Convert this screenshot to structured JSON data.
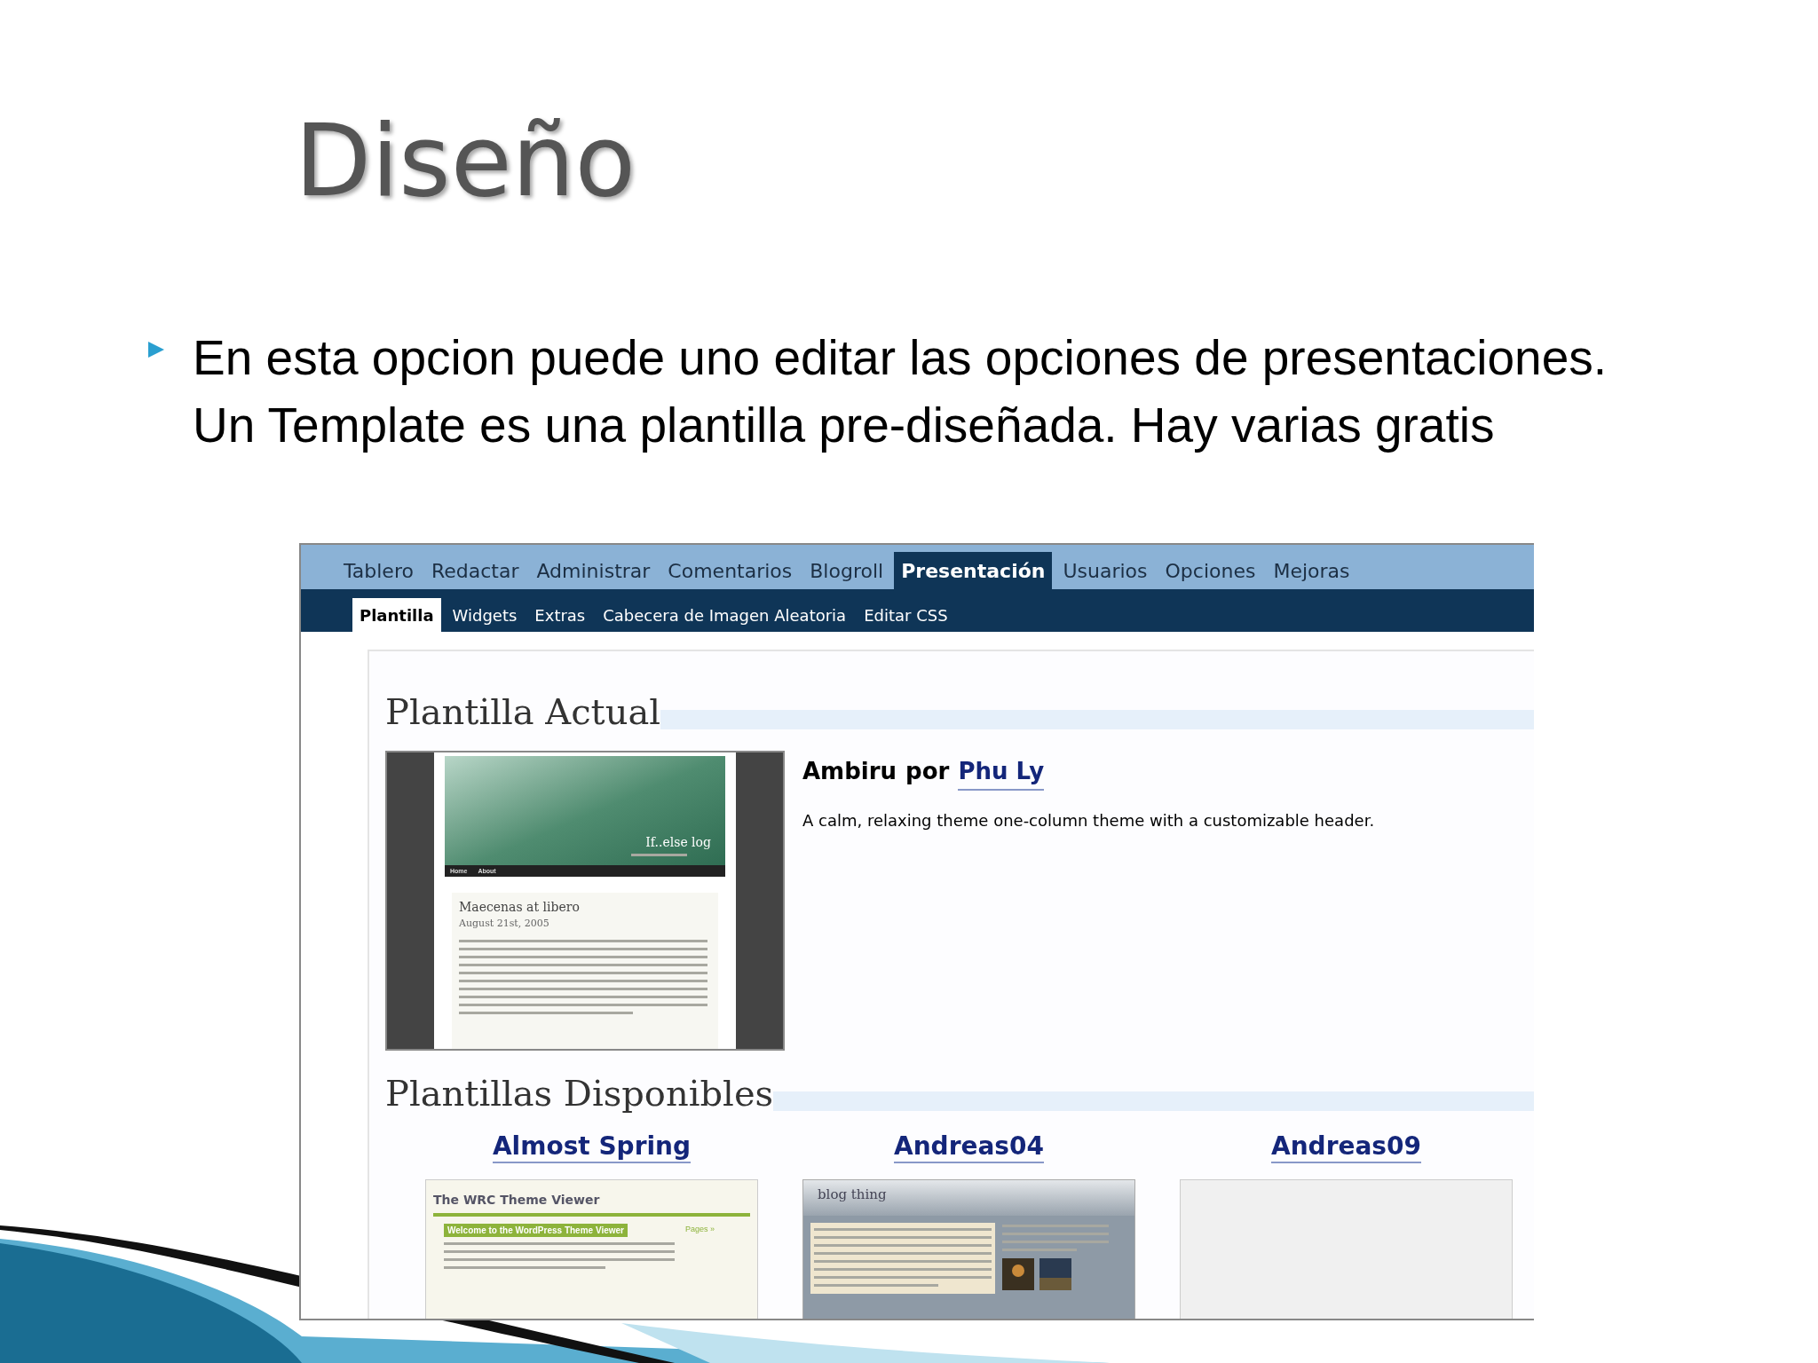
{
  "title": "Diseño",
  "bullets": [
    "En esta opcion puede uno editar las opciones de presentaciones. Un Template es una plantilla pre-diseñada. Hay varias gratis"
  ],
  "admin": {
    "menu": [
      {
        "label": "Tablero",
        "selected": false
      },
      {
        "label": "Redactar",
        "selected": false
      },
      {
        "label": "Administrar",
        "selected": false
      },
      {
        "label": "Comentarios",
        "selected": false
      },
      {
        "label": "Blogroll",
        "selected": false
      },
      {
        "label": "Presentación",
        "selected": true
      },
      {
        "label": "Usuarios",
        "selected": false
      },
      {
        "label": "Opciones",
        "selected": false
      },
      {
        "label": "Mejoras",
        "selected": false
      }
    ],
    "submenu": [
      {
        "label": "Plantilla",
        "selected": true
      },
      {
        "label": "Widgets",
        "selected": false
      },
      {
        "label": "Extras",
        "selected": false
      },
      {
        "label": "Cabecera de Imagen Aleatoria",
        "selected": false
      },
      {
        "label": "Editar CSS",
        "selected": false
      }
    ],
    "current_heading": "Plantilla Actual",
    "current_theme": {
      "name": "Ambiru",
      "by": "por",
      "author": "Phu Ly",
      "description": "A calm, relaxing theme one-column theme with a customizable header.",
      "preview": {
        "blog_title": "If..else log",
        "nav": [
          "Home",
          "About"
        ],
        "post_title": "Maecenas at libero",
        "post_date": "August 21st, 2005"
      }
    },
    "available_heading": "Plantillas Disponibles",
    "available": [
      {
        "name": "Almost Spring",
        "preview": {
          "kind": "light",
          "title": "The WRC Theme Viewer",
          "post_title": "Welcome to the WordPress Theme Viewer",
          "side": "Pages »"
        }
      },
      {
        "name": "Andreas04",
        "preview": {
          "kind": "dark",
          "title": "blog thing"
        }
      },
      {
        "name": "Andreas09",
        "preview": {
          "kind": "blank"
        }
      }
    ]
  }
}
